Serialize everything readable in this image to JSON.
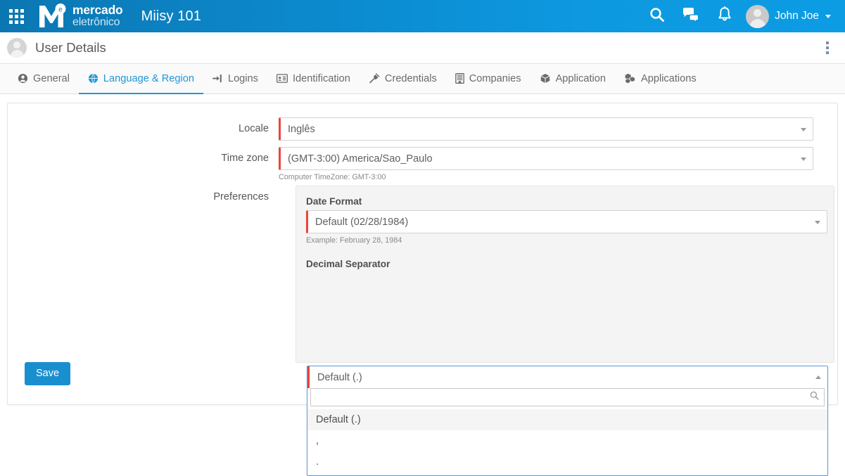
{
  "topbar": {
    "apps_grid_icon": "apps-grid-icon",
    "brand": {
      "m_badge": "e",
      "line1": "mercado",
      "line2": "eletrônico"
    },
    "app_title": "Miisy 101",
    "search_icon": "search-icon",
    "chat_icon": "chat-bubbles-icon",
    "bell_icon": "notification-bell-icon",
    "user_name": "John Joe",
    "user_caret_icon": "chevron-down-icon",
    "accent_color": "#0c9ce4"
  },
  "pagehead": {
    "avatar_icon": "user-avatar-icon",
    "title": "User Details",
    "kebab_icon": "more-vertical-icon"
  },
  "tabs": [
    {
      "label": "General",
      "icon": "user-circle-icon",
      "active": false
    },
    {
      "label": "Language & Region",
      "icon": "globe-icon",
      "active": true
    },
    {
      "label": "Logins",
      "icon": "sign-in-icon",
      "active": false
    },
    {
      "label": "Identification",
      "icon": "id-card-icon",
      "active": false
    },
    {
      "label": "Credentials",
      "icon": "plug-icon",
      "active": false
    },
    {
      "label": "Companies",
      "icon": "building-icon",
      "active": false
    },
    {
      "label": "Application",
      "icon": "cube-icon",
      "active": false
    },
    {
      "label": "Applications",
      "icon": "cubes-icon",
      "active": false
    }
  ],
  "form": {
    "locale": {
      "label": "Locale",
      "value": "Inglês",
      "required": true,
      "caret_icon": "chevron-down-icon"
    },
    "timezone": {
      "label": "Time zone",
      "value": "(GMT-3:00) America/Sao_Paulo",
      "required": true,
      "helper": "Computer TimeZone: GMT-3:00",
      "caret_icon": "chevron-down-icon"
    },
    "preferences": {
      "label": "Preferences",
      "date_format": {
        "label": "Date Format",
        "value": "Default (02/28/1984)",
        "required": true,
        "helper": "Example: February 28, 1984",
        "caret_icon": "chevron-down-icon"
      },
      "decimal_separator": {
        "label": "Decimal Separator",
        "value": "Default (.)",
        "required": true,
        "open": true,
        "caret_icon": "chevron-up-icon",
        "search_value": "",
        "search_placeholder": "",
        "search_icon": "search-icon",
        "options": [
          {
            "label": "Default (.)",
            "selected": true
          },
          {
            "label": ",",
            "selected": false
          },
          {
            "label": ".",
            "selected": false
          }
        ]
      }
    }
  },
  "actions": {
    "save_label": "Save",
    "save_color": "#1a8fd0"
  },
  "required_marker_color": "#e8453c"
}
